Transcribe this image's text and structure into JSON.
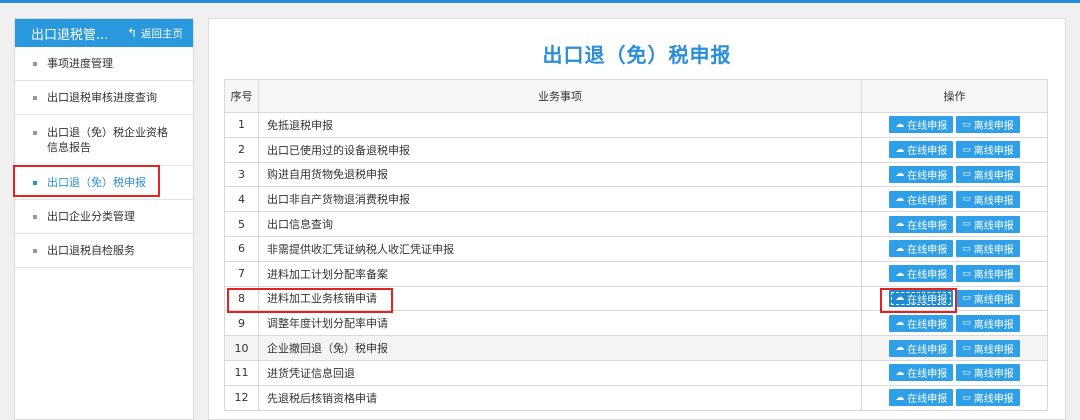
{
  "sidebar": {
    "title": "出口退税管...",
    "home_label": "返回主页",
    "items": [
      {
        "label": "事项进度管理"
      },
      {
        "label": "出口退税审核进度查询"
      },
      {
        "label": "出口退（免）税企业资格信息报告"
      },
      {
        "label": "出口退（免）税申报"
      },
      {
        "label": "出口企业分类管理"
      },
      {
        "label": "出口退税自检服务"
      }
    ]
  },
  "main": {
    "title": "出口退（免）税申报",
    "table": {
      "headers": [
        "序号",
        "业务事项",
        "操作"
      ],
      "online_label": "在线申报",
      "offline_label": "离线申报",
      "rows": [
        {
          "idx": "1",
          "name": "免抵退税申报"
        },
        {
          "idx": "2",
          "name": "出口已使用过的设备退税申报"
        },
        {
          "idx": "3",
          "name": "购进自用货物免退税申报"
        },
        {
          "idx": "4",
          "name": "出口非自产货物退消费税申报"
        },
        {
          "idx": "5",
          "name": "出口信息查询"
        },
        {
          "idx": "6",
          "name": "非需提供收汇凭证纳税人收汇凭证申报"
        },
        {
          "idx": "7",
          "name": "进料加工计划分配率备案"
        },
        {
          "idx": "8",
          "name": "进料加工业务核销申请"
        },
        {
          "idx": "9",
          "name": "调整年度计划分配率申请"
        },
        {
          "idx": "10",
          "name": "企业撤回退（免）税申报"
        },
        {
          "idx": "11",
          "name": "进货凭证信息回退"
        },
        {
          "idx": "12",
          "name": "先退税后核销资格申请"
        }
      ]
    }
  },
  "colors": {
    "accent": "#2a98dc",
    "highlight": "#e52222",
    "button": "#2f9fe8"
  },
  "icons": {
    "home": "back-arrow-icon",
    "online": "cloud-upload-icon",
    "offline": "monitor-icon"
  }
}
